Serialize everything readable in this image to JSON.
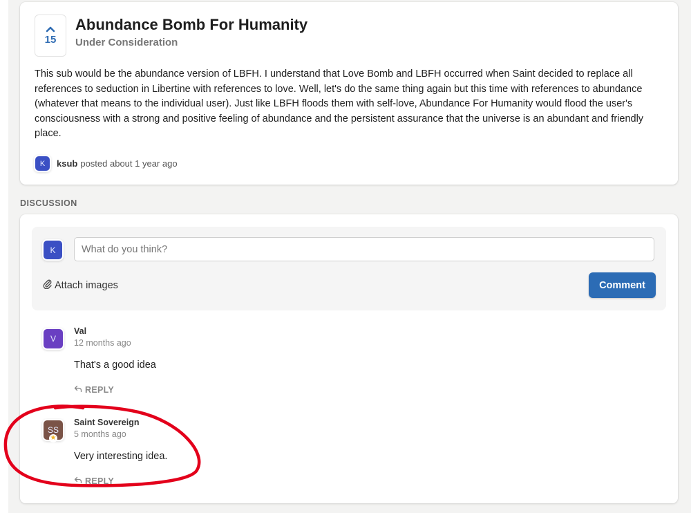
{
  "post": {
    "votes": "15",
    "title": "Abundance Bomb For Humanity",
    "status": "Under Consideration",
    "body": "This sub would be the abundance version of LBFH. I understand that Love Bomb and LBFH occurred when Saint decided to replace all references to seduction in Libertine with references to love. Well, let's do the same thing again but this time with references to abundance (whatever that means to the individual user). Just like LBFH floods them with self-love, Abundance For Humanity would flood the user's consciousness with a strong and positive feeling of abundance and the persistent assurance that the universe is an abundant and friendly place.",
    "author_initial": "K",
    "author": "ksub",
    "posted_text": "posted about 1 year ago"
  },
  "discussion": {
    "label": "DISCUSSION",
    "composer": {
      "avatar_initial": "K",
      "placeholder": "What do you think?",
      "attach_label": "Attach images",
      "submit_label": "Comment"
    },
    "comments": [
      {
        "avatar_initials": "V",
        "avatar_color": "#6a3fc2",
        "name": "Val",
        "time": "12 months ago",
        "text": "That's a good idea",
        "reply_label": "REPLY"
      },
      {
        "avatar_initials": "SS",
        "avatar_color": "#7a5347",
        "name": "Saint Sovereign",
        "time": "5 months ago",
        "text": "Very interesting idea.",
        "reply_label": "REPLY",
        "badge_icon": "star-icon"
      }
    ]
  },
  "colors": {
    "accent": "#2c6cb5",
    "annotation": "#e3001b"
  }
}
